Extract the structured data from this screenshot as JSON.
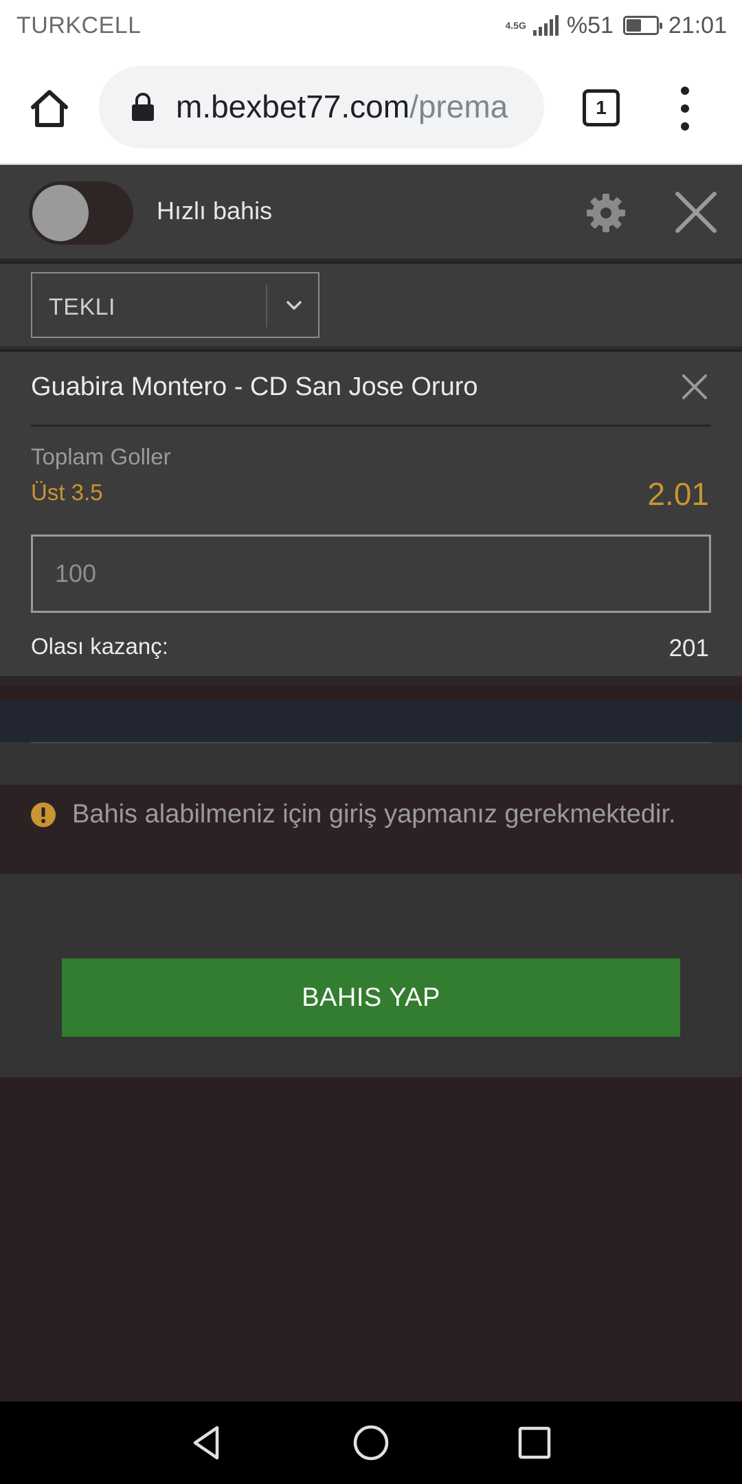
{
  "status_bar": {
    "carrier": "TURKCELL",
    "network_type": "4.5G",
    "battery_percent": "%51",
    "battery_level": 0.51,
    "time": "21:01"
  },
  "browser": {
    "url_domain": "m.bexbet77.com",
    "url_path": "/prema",
    "tab_count": "1"
  },
  "bet_slip": {
    "quick_bet_label": "Hızlı bahis",
    "quick_bet_enabled": false,
    "bet_type": "TEKLI",
    "event": {
      "title": "Guabira Montero - CD San Jose Oruro",
      "market": "Toplam Goller",
      "selection": "Üst 3.5",
      "odds": "2.01"
    },
    "stake_placeholder": "100",
    "possible_win_label": "Olası kazanç:",
    "possible_win_value": "201",
    "login_warning": "Bahis alabilmeniz için giriş yapmanız gerekmektedir.",
    "place_bet_label": "BAHIS YAP"
  },
  "colors": {
    "accent_odds": "#c99432",
    "bet_button": "#337d30",
    "panel": "#3c3c3c"
  }
}
